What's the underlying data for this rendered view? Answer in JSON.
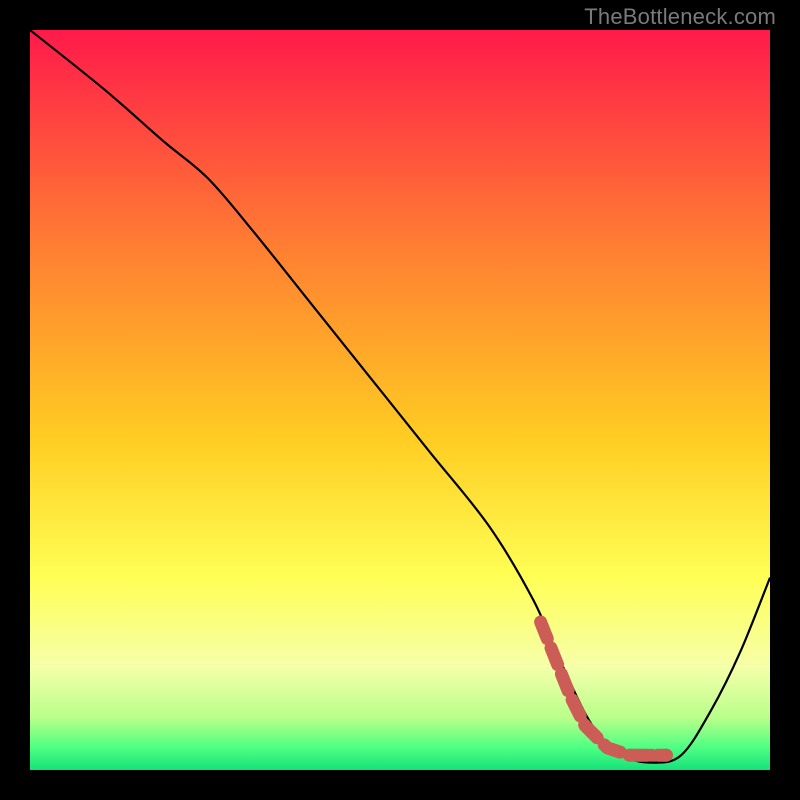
{
  "attribution": "TheBottleneck.com",
  "colors": {
    "bg_top": "#ff1a4a",
    "bg_mid_upper": "#ff7a33",
    "bg_mid": "#ffcc22",
    "bg_mid_lower": "#ffff55",
    "bg_lower": "#f6ffaa",
    "bg_green1": "#b8ff8a",
    "bg_green2": "#4dff82",
    "bg_green3": "#15e27a",
    "curve": "#000000",
    "dots": "#cc5d56",
    "frame": "#000000"
  },
  "chart_data": {
    "type": "line",
    "title": "",
    "xlabel": "",
    "ylabel": "",
    "xlim": [
      0,
      100
    ],
    "ylim": [
      0,
      100
    ],
    "series": [
      {
        "name": "bottleneck-curve",
        "x": [
          0,
          10,
          18,
          24,
          30,
          38,
          46,
          54,
          62,
          68,
          72,
          76,
          80,
          84,
          88,
          92,
          96,
          100
        ],
        "y": [
          100,
          92,
          85,
          80,
          73,
          63,
          53,
          43,
          33,
          23,
          14,
          6,
          2,
          1,
          2,
          8,
          16,
          26
        ]
      },
      {
        "name": "optimal-range-dots",
        "x": [
          69,
          71,
          73,
          75,
          78,
          81,
          84,
          86
        ],
        "y": [
          20,
          15,
          10,
          6,
          3,
          2,
          2,
          2
        ]
      }
    ],
    "gradient_stops": [
      {
        "offset": 0,
        "color_key": "bg_top"
      },
      {
        "offset": 0.28,
        "color_key": "bg_mid_upper"
      },
      {
        "offset": 0.55,
        "color_key": "bg_mid"
      },
      {
        "offset": 0.74,
        "color_key": "bg_mid_lower"
      },
      {
        "offset": 0.86,
        "color_key": "bg_lower"
      },
      {
        "offset": 0.93,
        "color_key": "bg_green1"
      },
      {
        "offset": 0.97,
        "color_key": "bg_green2"
      },
      {
        "offset": 1.0,
        "color_key": "bg_green3"
      }
    ]
  }
}
